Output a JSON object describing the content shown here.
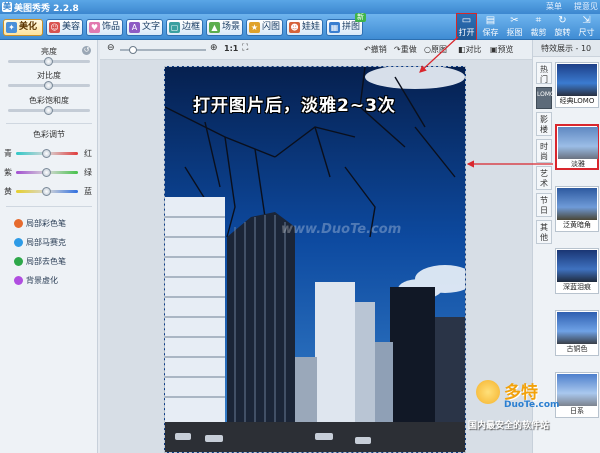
{
  "app": {
    "title": "美图秀秀 2.2.8",
    "top_right": [
      "菜单",
      "提意见"
    ]
  },
  "tabs": [
    {
      "label": "美化",
      "icon": "magic-wand-icon",
      "active": true,
      "color": "#4a90d9"
    },
    {
      "label": "美容",
      "icon": "face-icon",
      "active": false,
      "color": "#d9534f"
    },
    {
      "label": "饰品",
      "icon": "heart-icon",
      "active": false,
      "color": "#e27ab0"
    },
    {
      "label": "文字",
      "icon": "text-icon",
      "active": false,
      "color": "#8e5bc4"
    },
    {
      "label": "边框",
      "icon": "frame-icon",
      "active": false,
      "color": "#3aa0a0"
    },
    {
      "label": "场景",
      "icon": "scene-icon",
      "active": false,
      "color": "#5cae4e"
    },
    {
      "label": "闪图",
      "icon": "flash-icon",
      "active": false,
      "color": "#e0a22b"
    },
    {
      "label": "娃娃",
      "icon": "doll-icon",
      "active": false,
      "color": "#d6633a"
    },
    {
      "label": "拼图",
      "icon": "puzzle-icon",
      "active": false,
      "color": "#3b7ed0",
      "badge": "新"
    }
  ],
  "tools": [
    {
      "label": "打开",
      "icon": "folder-open-icon",
      "highlight": true
    },
    {
      "label": "保存",
      "icon": "save-icon",
      "highlight": false
    },
    {
      "label": "抠图",
      "icon": "cutout-icon",
      "highlight": false
    },
    {
      "label": "裁剪",
      "icon": "crop-icon",
      "highlight": false
    },
    {
      "label": "旋转",
      "icon": "rotate-icon",
      "highlight": false
    },
    {
      "label": "尺寸",
      "icon": "resize-icon",
      "highlight": false
    }
  ],
  "left_panel": {
    "brightness_label": "亮度",
    "contrast_label": "对比度",
    "saturation_label": "色彩饱和度",
    "brightness": 0.5,
    "contrast": 0.5,
    "saturation": 0.5,
    "color_adjust_label": "色彩调节",
    "color_rows": [
      {
        "left": "青",
        "right": "红",
        "value": 0.5,
        "from": "#2fc7c7",
        "to": "#e03b3b"
      },
      {
        "left": "紫",
        "right": "绿",
        "value": 0.5,
        "from": "#a24ed1",
        "to": "#45c24a"
      },
      {
        "left": "黄",
        "right": "蓝",
        "value": 0.5,
        "from": "#e6cf2a",
        "to": "#2f6fe0"
      }
    ],
    "brushes": [
      {
        "label": "局部彩色笔",
        "color": "#e66b2e"
      },
      {
        "label": "局部马赛克",
        "color": "#2e9be6"
      },
      {
        "label": "局部去色笔",
        "color": "#2ea84a"
      },
      {
        "label": "背景虚化",
        "color": "#b04ee0"
      }
    ]
  },
  "subbar": {
    "zoom_ratio": "1:1",
    "zoom_value": 0.1,
    "undo": "撤销",
    "redo": "重做",
    "original": "原图",
    "compare": "对比",
    "preview": "预览"
  },
  "canvas": {
    "overlay_text": "打开图片后，淡雅2~3次",
    "watermark": "www.DuoTe.com"
  },
  "right_panel": {
    "header": "特效展示 - 10",
    "vtabs": [
      {
        "label": "热门",
        "active": false
      },
      {
        "label": "LOMO",
        "active": true
      },
      {
        "label": "影楼",
        "active": false
      },
      {
        "label": "时尚",
        "active": false
      },
      {
        "label": "艺术",
        "active": false
      },
      {
        "label": "节日",
        "active": false
      },
      {
        "label": "其他",
        "active": false
      }
    ],
    "effects": [
      {
        "label": "经典LOMO",
        "selected": false
      },
      {
        "label": "淡雅",
        "selected": true
      },
      {
        "label": "泛黄暗角",
        "selected": false
      },
      {
        "label": "深蓝泪痕",
        "selected": false
      },
      {
        "label": "古铜色",
        "selected": false
      },
      {
        "label": "日系",
        "selected": false
      }
    ]
  },
  "site_badge": {
    "name": "多特",
    "domain": "DuoTe.com",
    "slogan": "国内最安全的软件站"
  },
  "colors": {
    "accent": "#3f8cd3",
    "highlight_red": "#d9262d",
    "sky_blue": "#0b3b86"
  }
}
